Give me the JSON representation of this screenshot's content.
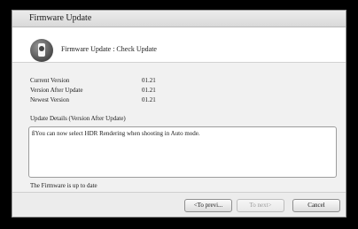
{
  "window": {
    "title": "Firmware Update"
  },
  "header": {
    "icon": "camera-icon",
    "title": "Firmware Update : Check Update"
  },
  "versions": [
    {
      "label": "Current Version",
      "value": "01.21"
    },
    {
      "label": "Version After Update",
      "value": "01.21"
    },
    {
      "label": "Newest Version",
      "value": "01.21"
    }
  ],
  "details": {
    "label": "Update Details (Version After Update)",
    "text": "ßYou can now select HDR Rendering when shooting in Auto mode."
  },
  "status": "The Firmware is up to date",
  "buttons": {
    "prev": "<To previ...",
    "next": "To next>",
    "cancel": "Cancel"
  }
}
